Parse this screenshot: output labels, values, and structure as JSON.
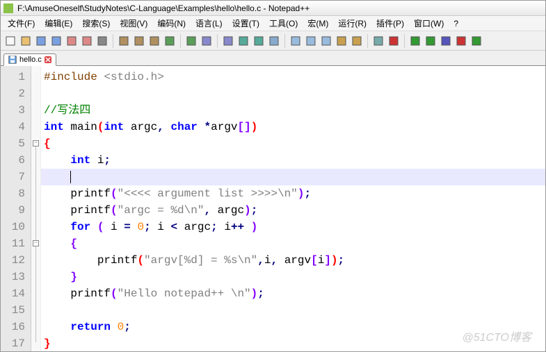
{
  "title": "F:\\AmuseOneself\\StudyNotes\\C-Language\\Examples\\hello\\hello.c - Notepad++",
  "menu": [
    "文件(F)",
    "编辑(E)",
    "搜索(S)",
    "视图(V)",
    "编码(N)",
    "语言(L)",
    "设置(T)",
    "工具(O)",
    "宏(M)",
    "运行(R)",
    "插件(P)",
    "窗口(W)",
    "?"
  ],
  "tab": {
    "name": "hello.c"
  },
  "watermark": "@51CTO博客",
  "code": {
    "lines": 17,
    "current_line": 7,
    "content": [
      {
        "n": 1,
        "tokens": [
          [
            "pp",
            "#include "
          ],
          [
            "str",
            "<stdio.h>"
          ]
        ]
      },
      {
        "n": 2,
        "tokens": [
          [
            "",
            ""
          ]
        ]
      },
      {
        "n": 3,
        "tokens": [
          [
            "cmt",
            "//写法四"
          ]
        ]
      },
      {
        "n": 4,
        "tokens": [
          [
            "kw",
            "int"
          ],
          [
            "",
            " main"
          ],
          [
            "brk0",
            "("
          ],
          [
            "kw",
            "int"
          ],
          [
            "",
            " argc"
          ],
          [
            "op",
            ","
          ],
          [
            "",
            " "
          ],
          [
            "kw",
            "char"
          ],
          [
            "",
            " "
          ],
          [
            "op",
            "*"
          ],
          [
            "",
            "argv"
          ],
          [
            "brk1",
            "["
          ],
          [
            "brk1",
            "]"
          ],
          [
            "brk0",
            ")"
          ]
        ]
      },
      {
        "n": 5,
        "tokens": [
          [
            "brk0",
            "{"
          ]
        ],
        "fold": "open"
      },
      {
        "n": 6,
        "tokens": [
          [
            "",
            "    "
          ],
          [
            "kw",
            "int"
          ],
          [
            "",
            " i"
          ],
          [
            "op",
            ";"
          ]
        ]
      },
      {
        "n": 7,
        "tokens": [
          [
            "",
            "    "
          ]
        ],
        "caret": true
      },
      {
        "n": 8,
        "tokens": [
          [
            "",
            "    printf"
          ],
          [
            "brk1",
            "("
          ],
          [
            "str",
            "\"<<<< argument list >>>>\\n\""
          ],
          [
            "brk1",
            ")"
          ],
          [
            "op",
            ";"
          ]
        ]
      },
      {
        "n": 9,
        "tokens": [
          [
            "",
            "    printf"
          ],
          [
            "brk1",
            "("
          ],
          [
            "str",
            "\"argc = %d\\n\""
          ],
          [
            "op",
            ","
          ],
          [
            "",
            " argc"
          ],
          [
            "brk1",
            ")"
          ],
          [
            "op",
            ";"
          ]
        ]
      },
      {
        "n": 10,
        "tokens": [
          [
            "",
            "    "
          ],
          [
            "kw",
            "for"
          ],
          [
            "",
            " "
          ],
          [
            "brk1",
            "("
          ],
          [
            "",
            " i "
          ],
          [
            "op",
            "="
          ],
          [
            "",
            " "
          ],
          [
            "num",
            "0"
          ],
          [
            "op",
            ";"
          ],
          [
            "",
            " i "
          ],
          [
            "op",
            "<"
          ],
          [
            "",
            " argc"
          ],
          [
            "op",
            ";"
          ],
          [
            "",
            " i"
          ],
          [
            "op",
            "++"
          ],
          [
            "",
            " "
          ],
          [
            "brk1",
            ")"
          ]
        ]
      },
      {
        "n": 11,
        "tokens": [
          [
            "",
            "    "
          ],
          [
            "brk1",
            "{"
          ]
        ],
        "fold": "open"
      },
      {
        "n": 12,
        "tokens": [
          [
            "",
            "        printf"
          ],
          [
            "brk0",
            "("
          ],
          [
            "str",
            "\"argv[%d] = %s\\n\""
          ],
          [
            "op",
            ","
          ],
          [
            "",
            "i"
          ],
          [
            "op",
            ","
          ],
          [
            "",
            " argv"
          ],
          [
            "brk1",
            "["
          ],
          [
            "",
            "i"
          ],
          [
            "brk1",
            "]"
          ],
          [
            "brk0",
            ")"
          ],
          [
            "op",
            ";"
          ]
        ]
      },
      {
        "n": 13,
        "tokens": [
          [
            "",
            "    "
          ],
          [
            "brk1",
            "}"
          ]
        ]
      },
      {
        "n": 14,
        "tokens": [
          [
            "",
            "    printf"
          ],
          [
            "brk1",
            "("
          ],
          [
            "str",
            "\"Hello notepad++ \\n\""
          ],
          [
            "brk1",
            ")"
          ],
          [
            "op",
            ";"
          ]
        ]
      },
      {
        "n": 15,
        "tokens": [
          [
            "",
            ""
          ]
        ]
      },
      {
        "n": 16,
        "tokens": [
          [
            "",
            "    "
          ],
          [
            "kw",
            "return"
          ],
          [
            "",
            " "
          ],
          [
            "num",
            "0"
          ],
          [
            "op",
            ";"
          ]
        ]
      },
      {
        "n": 17,
        "tokens": [
          [
            "brk0",
            "}"
          ]
        ]
      }
    ]
  },
  "toolbar_icons": [
    "new",
    "open",
    "save",
    "save-all",
    "close",
    "close-all",
    "print",
    "cut",
    "copy",
    "paste",
    "undo",
    "redo",
    "find",
    "replace",
    "zoom-in",
    "zoom-out",
    "sync",
    "wordwrap",
    "allchars",
    "indent-guide",
    "lang",
    "folder",
    "monitor",
    "record",
    "play",
    "play-fast",
    "stop",
    "record2",
    "run"
  ]
}
